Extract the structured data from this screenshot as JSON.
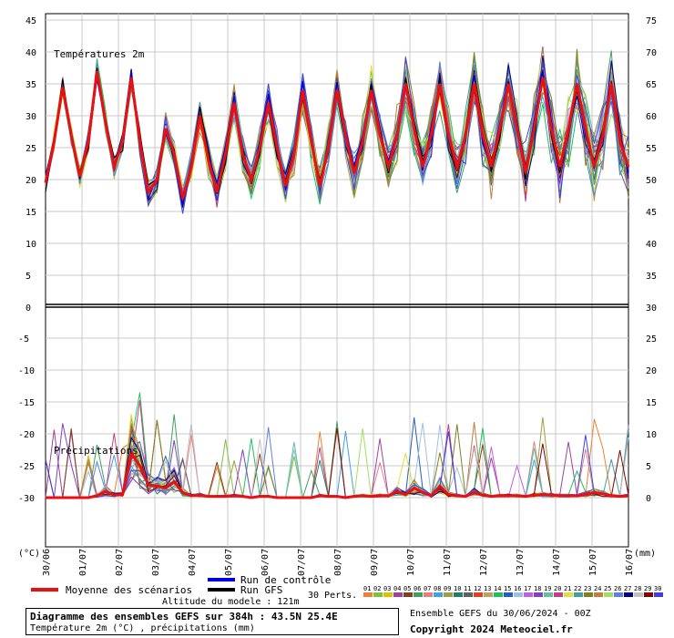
{
  "chart_data": {
    "type": "line",
    "upper_panel": {
      "label": "Températures 2m",
      "left_ticks": [
        45,
        40,
        35,
        30,
        25,
        20,
        15,
        10,
        5,
        0
      ],
      "right_ticks": [
        75,
        70,
        65,
        60,
        55,
        50,
        45,
        40,
        35,
        30
      ]
    },
    "lower_panel": {
      "label": "Précipitations",
      "left_ticks": [
        -5,
        -10,
        -15,
        -20,
        -25,
        -30
      ],
      "right_ticks": [
        25,
        20,
        15,
        10,
        5,
        0
      ]
    },
    "x_labels": [
      "30/06",
      "01/07",
      "02/07",
      "03/07",
      "04/07",
      "05/07",
      "06/07",
      "07/07",
      "08/07",
      "09/07",
      "10/07",
      "11/07",
      "12/07",
      "13/07",
      "14/07",
      "15/07",
      "16/07"
    ],
    "left_unit": "(°C)",
    "right_unit": "(mm)",
    "mean_temperature": [
      19.5,
      26,
      34.5,
      27,
      20.5,
      26,
      37,
      29,
      22,
      26,
      36,
      26,
      18,
      20,
      28,
      24,
      17,
      22,
      30,
      23,
      18,
      24,
      32,
      24,
      20,
      25,
      32,
      25,
      19,
      24,
      34,
      26,
      19,
      25,
      34,
      27,
      21,
      26,
      34,
      27,
      22,
      27,
      35,
      28,
      22,
      27,
      35,
      27,
      22,
      27,
      35,
      27,
      22,
      28,
      35,
      28,
      21,
      28,
      36,
      28,
      22,
      28,
      35,
      28,
      22,
      27,
      35,
      26,
      22
    ],
    "mean_precip": [
      0,
      0,
      0,
      0,
      0,
      0,
      0.3,
      1,
      0.4,
      0.5,
      7,
      5,
      2,
      1.8,
      1.5,
      2.5,
      0.8,
      0.3,
      0.4,
      0.2,
      0.2,
      0.2,
      0.3,
      0.2,
      0,
      0.2,
      0.2,
      0,
      0,
      0,
      0,
      0,
      0.3,
      0.2,
      0.2,
      0,
      0.2,
      0.3,
      0.2,
      0.3,
      0.3,
      1,
      0.5,
      1.5,
      0.8,
      0.3,
      1.8,
      0.5,
      0.3,
      0.2,
      0.8,
      0.4,
      0.2,
      0.3,
      0.3,
      0.3,
      0.2,
      0.4,
      0.5,
      0.4,
      0.3,
      0.3,
      0.3,
      0.5,
      0.8,
      0.6,
      0.3,
      0.2,
      0.3
    ],
    "legend": {
      "mean": "Moyenne des scénarios",
      "control": "Run de contrôle",
      "gfs": "Run GFS",
      "perts": "30 Perts.",
      "mean_color": "#e81010",
      "control_color": "#0000e0",
      "gfs_color": "#000000"
    },
    "perturbation_numbers": [
      "01",
      "02",
      "03",
      "04",
      "05",
      "06",
      "07",
      "08",
      "09",
      "10",
      "11",
      "12",
      "13",
      "14",
      "15",
      "16",
      "17",
      "18",
      "19",
      "20",
      "21",
      "22",
      "23",
      "24",
      "25",
      "26",
      "27",
      "28",
      "29",
      "30"
    ],
    "perturbation_colors": [
      "#f08030",
      "#80c040",
      "#e0c000",
      "#a040a0",
      "#804020",
      "#40a060",
      "#e08080",
      "#40a0e0",
      "#a0a040",
      "#208060",
      "#606060",
      "#e04020",
      "#c0a060",
      "#20c060",
      "#2060c0",
      "#a0c0e0",
      "#c060e0",
      "#8040c0",
      "#60c0a0",
      "#c04080",
      "#e0e040",
      "#40a0a0",
      "#808020",
      "#c08040",
      "#a0e060",
      "#6080e0",
      "#000080",
      "#c0c0c0",
      "#800000",
      "#4040e0"
    ]
  },
  "footer": {
    "title": "Diagramme des ensembles GEFS sur 384h : 43.5N 25.4E",
    "subtitle": "Température 2m (°C) , précipitations (mm)",
    "altitude": "Altitude du modele : 121m",
    "ensemble_info": "Ensemble GEFS du 30/06/2024 - 00Z",
    "copyright": "Copyright 2024 Meteociel.fr"
  }
}
